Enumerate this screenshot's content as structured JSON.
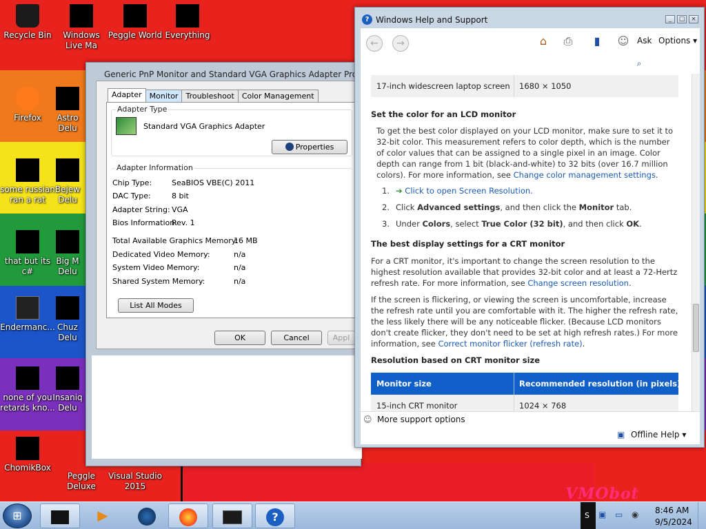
{
  "desktop": {
    "icons": [
      {
        "label": "Recycle Bin"
      },
      {
        "label": "Windows Live Ma"
      },
      {
        "label": "Peggle World"
      },
      {
        "label": "Everything"
      },
      {
        "label": "Firefox"
      },
      {
        "label": "Astro Delu"
      },
      {
        "label": "some russian ran a rat"
      },
      {
        "label": "Bejew Delu"
      },
      {
        "label": "that but its c#"
      },
      {
        "label": "Big M Delu"
      },
      {
        "label": "Endermanc..."
      },
      {
        "label": "Chuz Delu"
      },
      {
        "label": "none of you retards kno..."
      },
      {
        "label": "Insaniq Delu"
      },
      {
        "label": "ChomikBox"
      },
      {
        "label": "Peggle Deluxe"
      },
      {
        "label": "Visual Studio 2015"
      }
    ],
    "watermark": "VMObot"
  },
  "props_dialog": {
    "title": "Generic PnP Monitor and Standard VGA Graphics Adapter Properties",
    "tabs": [
      "Adapter",
      "Monitor",
      "Troubleshoot",
      "Color Management"
    ],
    "adapter_type_label": "Adapter Type",
    "adapter_name": "Standard VGA Graphics Adapter",
    "properties_button": "Properties",
    "adapter_info_label": "Adapter Information",
    "info": [
      {
        "label": "Chip Type:",
        "value": "SeaBIOS VBE(C) 2011"
      },
      {
        "label": "DAC Type:",
        "value": "8 bit"
      },
      {
        "label": "Adapter String:",
        "value": "VGA"
      },
      {
        "label": "Bios Information:",
        "value": "Rev. 1"
      }
    ],
    "memory": [
      {
        "label": "Total Available Graphics Memory:",
        "value": "16 MB"
      },
      {
        "label": "Dedicated Video Memory:",
        "value": "n/a"
      },
      {
        "label": "System Video Memory:",
        "value": "n/a"
      },
      {
        "label": "Shared System Memory:",
        "value": "n/a"
      }
    ],
    "list_modes_button": "List All Modes",
    "ok": "OK",
    "cancel": "Cancel",
    "apply": "Appl"
  },
  "help": {
    "title": "Windows Help and Support",
    "ask": "Ask",
    "options": "Options",
    "top_row": {
      "c1": "17-inch widescreen laptop screen",
      "c2": "1680 × 1050"
    },
    "lcd_heading": "Set the color for an LCD monitor",
    "lcd_para_1": "To get the best color displayed on your LCD monitor, make sure to set it to 32-bit color. This measurement refers to color depth, which is the number of color values that can be assigned to a single pixel in an image. Color depth can range from 1 bit (black-and-white) to 32 bits (over 16.7 million colors). For more information, see ",
    "lcd_link": "Change color management settings",
    "steps": [
      {
        "num": "1.",
        "link": "Click to open Screen Resolution."
      },
      {
        "num": "2.",
        "pre": "Click ",
        "bold": "Advanced settings",
        "mid": ", and then click the ",
        "bold2": "Monitor",
        "post": " tab."
      },
      {
        "num": "3.",
        "pre": "Under ",
        "bold": "Colors",
        "mid": ", select ",
        "bold2": "True Color (32 bit)",
        "post": ", and then click ",
        "bold3": "OK",
        "end": "."
      }
    ],
    "crt_heading": "The best display settings for a CRT monitor",
    "crt_para_1": "For a CRT monitor, it's important to change the screen resolution to the highest resolution available that provides 32-bit color and at least a 72-Hertz refresh rate. For more information, see ",
    "crt_link_1": "Change screen resolution",
    "crt_para_2": "If the screen is flickering, or viewing the screen is uncomfortable, increase the refresh rate until you are comfortable with it. The higher the refresh rate, the less likely there will be any noticeable flicker. (Because LCD monitors don't create flicker, they don't need to be set at high refresh rates.) For more information, see ",
    "crt_link_2": "Correct monitor flicker (refresh rate)",
    "res_heading": "Resolution based on CRT monitor size",
    "table_head": {
      "c1": "Monitor size",
      "c2": "Recommended resolution (in pixels)"
    },
    "table_row": {
      "c1": "15-inch CRT monitor",
      "c2": "1024 × 768"
    },
    "more_support": "More support options",
    "offline_help": "Offline Help"
  },
  "taskbar": {
    "time": "8:46 AM",
    "date": "9/5/2024"
  },
  "colors": {
    "link": "#1a5bb5",
    "table_header": "#1160c9"
  }
}
